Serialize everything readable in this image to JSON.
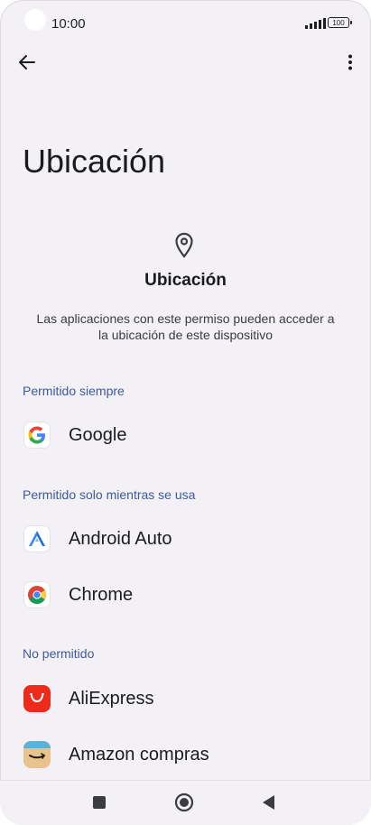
{
  "status": {
    "time": "10:00",
    "battery": "100"
  },
  "toolbar": {
    "back_icon": "arrow-back-icon",
    "more_icon": "more-vert-icon"
  },
  "page": {
    "title": "Ubicación"
  },
  "header": {
    "icon": "location-pin-icon",
    "title": "Ubicación",
    "description": "Las aplicaciones con este permiso pueden acceder a la ubicación de este dispositivo"
  },
  "sections": [
    {
      "label": "Permitido siempre",
      "apps": [
        {
          "name": "Google",
          "icon": "google-icon"
        }
      ]
    },
    {
      "label": "Permitido solo mientras se usa",
      "apps": [
        {
          "name": "Android Auto",
          "icon": "android-auto-icon"
        },
        {
          "name": "Chrome",
          "icon": "chrome-icon"
        }
      ]
    },
    {
      "label": "No permitido",
      "apps": [
        {
          "name": "AliExpress",
          "icon": "aliexpress-icon"
        },
        {
          "name": "Amazon compras",
          "icon": "amazon-icon"
        }
      ]
    }
  ],
  "nav": {
    "recents_icon": "square-icon",
    "home_icon": "circle-icon",
    "back_icon": "triangle-back-icon"
  },
  "colors": {
    "background": "#f3f1f5",
    "section_label": "#3c5a9e",
    "text": "#1b1b1f",
    "aliexpress": "#ee2b1b",
    "amazon": "#e9c38d"
  }
}
